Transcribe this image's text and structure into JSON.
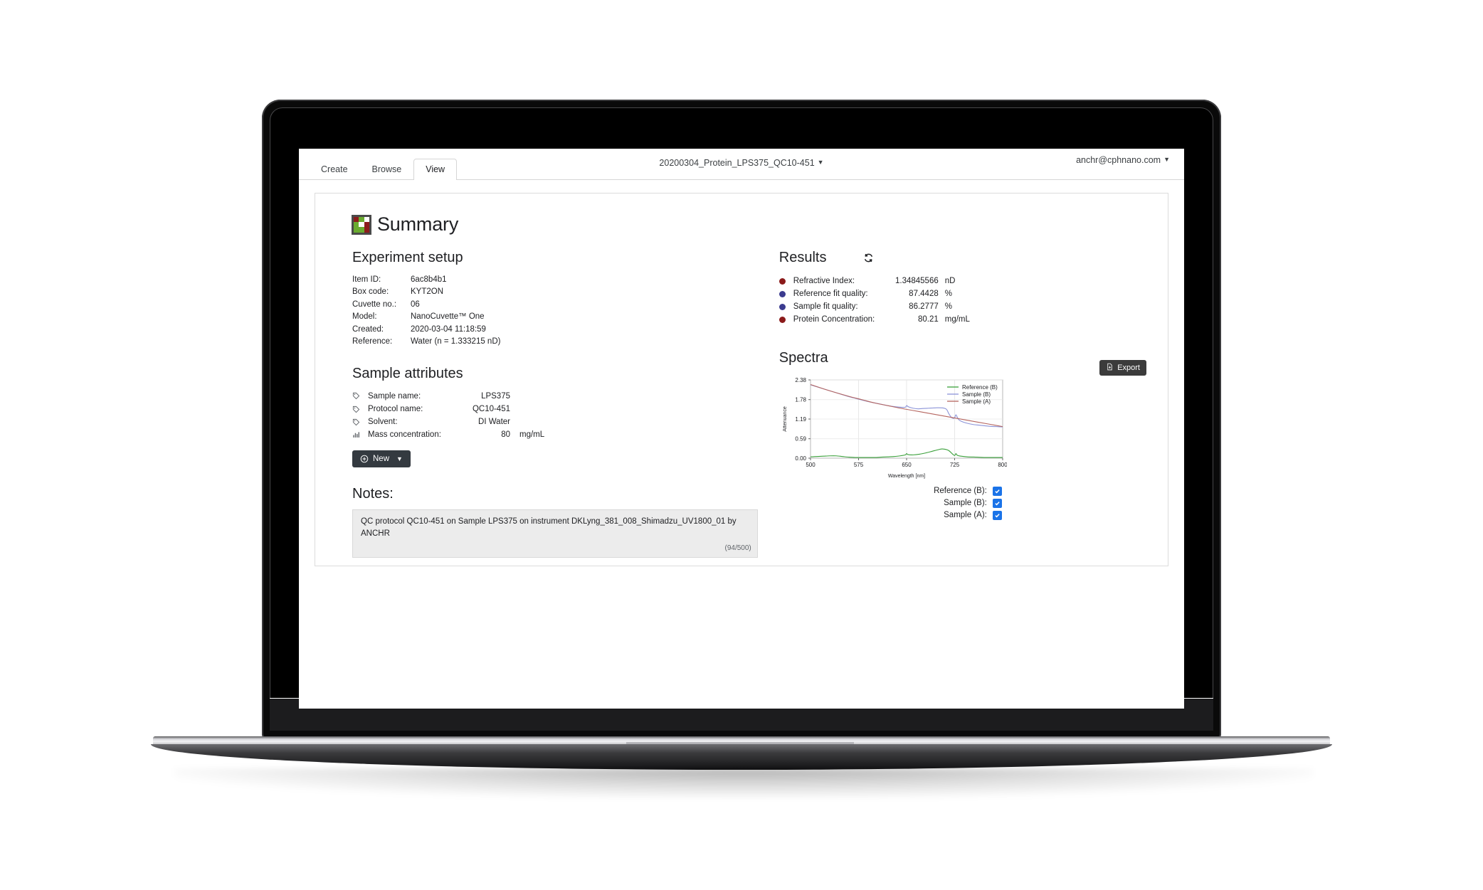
{
  "header": {
    "tabs": [
      {
        "label": "Create",
        "active": false
      },
      {
        "label": "Browse",
        "active": false
      },
      {
        "label": "View",
        "active": true
      }
    ],
    "document_title": "20200304_Protein_LPS375_QC10-451",
    "user_email": "anchr@cphnano.com"
  },
  "page": {
    "title": "Summary",
    "logo_colors": [
      "#8c1c1c",
      "#6aab2f",
      "#ffffff",
      "#6aab2f",
      "#ffffff",
      "#8c1c1c",
      "#6aab2f",
      "#6aab2f",
      "#8c1c1c"
    ]
  },
  "experiment_setup": {
    "heading": "Experiment setup",
    "rows": [
      {
        "key": "Item ID:",
        "value": "6ac8b4b1"
      },
      {
        "key": "Box code:",
        "value": "KYT2ON"
      },
      {
        "key": "Cuvette no.:",
        "value": "06"
      },
      {
        "key": "Model:",
        "value": "NanoCuvette™ One"
      },
      {
        "key": "Created:",
        "value": "2020-03-04 11:18:59"
      },
      {
        "key": "Reference:",
        "value": "Water (n = 1.333215 nD)"
      }
    ]
  },
  "sample_attributes": {
    "heading": "Sample attributes",
    "rows": [
      {
        "icon": "tag-icon",
        "label": "Sample name:",
        "value": "LPS375",
        "unit": ""
      },
      {
        "icon": "tag-icon",
        "label": "Protocol name:",
        "value": "QC10-451",
        "unit": ""
      },
      {
        "icon": "tag-icon",
        "label": "Solvent:",
        "value": "DI Water",
        "unit": ""
      },
      {
        "icon": "chart-icon",
        "label": "Mass concentration:",
        "value": "80",
        "unit": "mg/mL"
      }
    ],
    "new_button": "New"
  },
  "notes": {
    "heading": "Notes:",
    "text": "QC protocol QC10-451 on Sample LPS375 on instrument DKLyng_381_008_Shimadzu_UV1800_01 by ANCHR",
    "counter": "(94/500)"
  },
  "results": {
    "heading": "Results",
    "refresh_icon": "refresh-icon",
    "rows": [
      {
        "color": "#8b1a1a",
        "label": "Refractive Index:",
        "value": "1.34845566",
        "unit": "nD"
      },
      {
        "color": "#3b3b8f",
        "label": "Reference fit quality:",
        "value": "87.4428",
        "unit": "%"
      },
      {
        "color": "#3b3b8f",
        "label": "Sample fit quality:",
        "value": "86.2777",
        "unit": "%"
      },
      {
        "color": "#8b1a1a",
        "label": "Protein Concentration:",
        "value": "80.21",
        "unit": "mg/mL"
      }
    ]
  },
  "spectra": {
    "heading": "Spectra",
    "export_button": "Export",
    "toggles": [
      {
        "label": "Reference (B):",
        "checked": true
      },
      {
        "label": "Sample (B):",
        "checked": true
      },
      {
        "label": "Sample (A):",
        "checked": true
      }
    ]
  },
  "chart_data": {
    "type": "line",
    "title": "",
    "xlabel": "Wavelength [nm]",
    "ylabel": "Attenuance",
    "xlim": [
      500,
      800
    ],
    "ylim": [
      0.0,
      2.38
    ],
    "xticks": [
      500,
      575,
      650,
      725,
      800
    ],
    "yticks": [
      0.0,
      0.59,
      1.19,
      1.78,
      2.38
    ],
    "ytick_labels": [
      "0.00",
      "0.59",
      "1.19",
      "1.78",
      "2.38"
    ],
    "grid": true,
    "legend_position": "top-right",
    "series": [
      {
        "name": "Reference (B)",
        "color": "#3aa03a",
        "x": [
          500,
          510,
          520,
          530,
          540,
          550,
          560,
          570,
          580,
          590,
          600,
          610,
          620,
          630,
          640,
          648,
          650,
          652,
          660,
          670,
          680,
          690,
          700,
          706,
          715,
          722,
          725,
          727,
          729,
          735,
          745,
          760,
          775,
          790,
          800
        ],
        "y": [
          0.04,
          0.05,
          0.06,
          0.07,
          0.07,
          0.05,
          0.03,
          0.02,
          0.02,
          0.02,
          0.02,
          0.03,
          0.04,
          0.05,
          0.07,
          0.1,
          0.14,
          0.11,
          0.1,
          0.12,
          0.16,
          0.21,
          0.26,
          0.28,
          0.24,
          0.12,
          0.08,
          0.14,
          0.09,
          0.06,
          0.04,
          0.03,
          0.02,
          0.02,
          0.02
        ]
      },
      {
        "name": "Sample (B)",
        "color": "#8b93d8",
        "x": [
          500,
          510,
          520,
          530,
          540,
          550,
          560,
          570,
          580,
          590,
          600,
          610,
          620,
          630,
          640,
          648,
          650,
          653,
          660,
          668,
          675,
          685,
          695,
          705,
          712,
          716,
          720,
          723,
          725,
          727,
          729,
          732,
          738,
          745,
          755,
          765,
          780,
          790,
          800
        ],
        "y": [
          2.23,
          2.17,
          2.11,
          2.05,
          1.99,
          1.93,
          1.87,
          1.82,
          1.77,
          1.72,
          1.68,
          1.64,
          1.6,
          1.57,
          1.55,
          1.55,
          1.6,
          1.56,
          1.52,
          1.5,
          1.51,
          1.52,
          1.53,
          1.53,
          1.49,
          1.35,
          1.24,
          1.21,
          1.23,
          1.32,
          1.25,
          1.16,
          1.1,
          1.06,
          1.02,
          1.0,
          0.97,
          0.96,
          0.95
        ]
      },
      {
        "name": "Sample (A)",
        "color": "#b5655f",
        "x": [
          500,
          520,
          540,
          560,
          580,
          600,
          620,
          640,
          660,
          680,
          700,
          720,
          740,
          760,
          780,
          800
        ],
        "y": [
          2.24,
          2.11,
          1.99,
          1.88,
          1.78,
          1.68,
          1.6,
          1.52,
          1.45,
          1.38,
          1.31,
          1.24,
          1.17,
          1.1,
          1.03,
          0.96
        ]
      }
    ]
  }
}
